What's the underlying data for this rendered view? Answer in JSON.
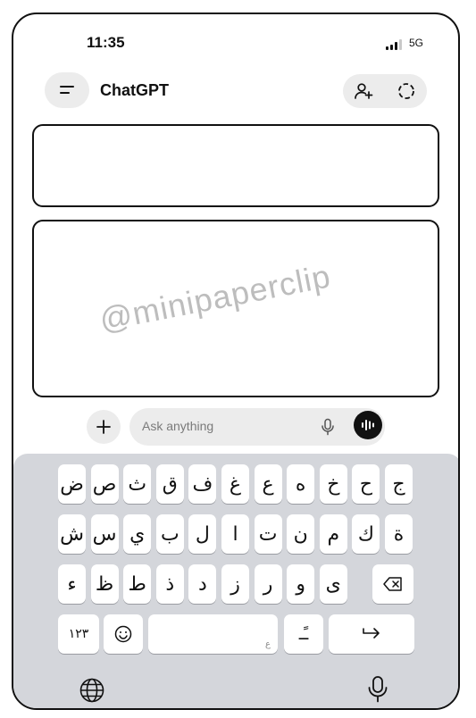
{
  "status_bar": {
    "time": "11:35",
    "network": "5G"
  },
  "header": {
    "title": "ChatGPT"
  },
  "watermark": "@minipaperclip",
  "composer": {
    "placeholder": "Ask anything"
  },
  "keyboard": {
    "row1": [
      "ض",
      "ص",
      "ث",
      "ق",
      "ف",
      "غ",
      "ع",
      "ه",
      "خ",
      "ح",
      "ج"
    ],
    "row2": [
      "ش",
      "س",
      "ي",
      "ب",
      "ل",
      "ا",
      "ت",
      "ن",
      "م",
      "ك",
      "ة"
    ],
    "row3": [
      "ء",
      "ظ",
      "ط",
      "ذ",
      "د",
      "ز",
      "ر",
      "و",
      "ى"
    ],
    "numbers_key": "١٢٣",
    "space_hint": "ع",
    "diacritic_key": "ـًـ"
  },
  "icons": [
    "menu-icon",
    "add-person-icon",
    "temporary-chat-icon",
    "plus-icon",
    "mic-icon",
    "voice-mode-icon",
    "backspace-icon",
    "emoji-icon",
    "return-icon",
    "globe-icon",
    "dictation-mic-icon"
  ],
  "colors": {
    "background": "#ffffff",
    "pill": "#ececec",
    "keyboard": "#d4d6db",
    "text": "#111111",
    "watermark": "#bdbdbd"
  }
}
